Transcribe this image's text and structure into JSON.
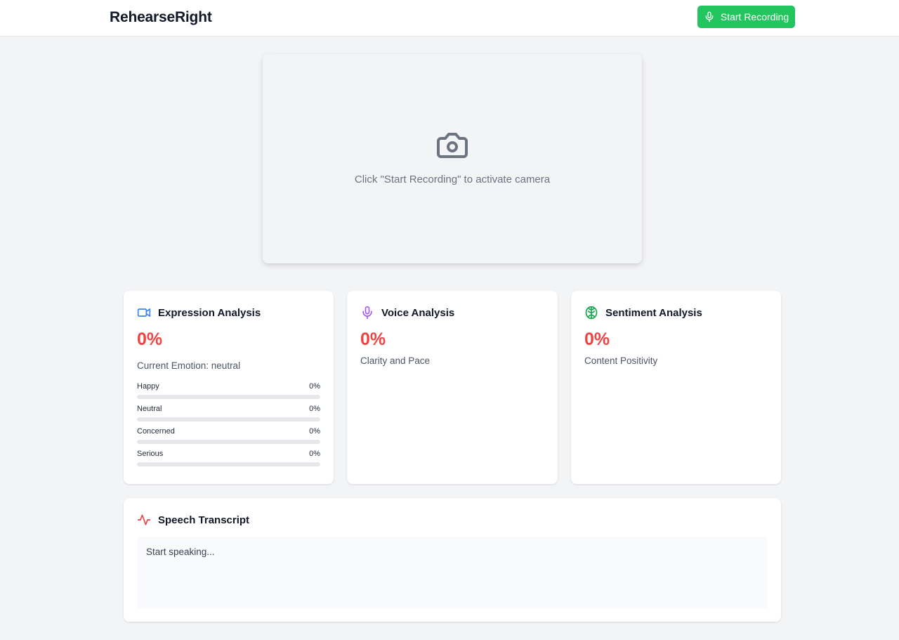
{
  "header": {
    "brand": "RehearseRight",
    "record_button_label": "Start Recording"
  },
  "camera": {
    "hint": "Click \"Start Recording\" to activate camera"
  },
  "expression": {
    "title": "Expression Analysis",
    "score": "0%",
    "current_emotion": "Current Emotion: neutral",
    "emotions": [
      {
        "label": "Happy",
        "percent": "0%",
        "level": 0
      },
      {
        "label": "Neutral",
        "percent": "0%",
        "level": 0
      },
      {
        "label": "Concerned",
        "percent": "0%",
        "level": 0
      },
      {
        "label": "Serious",
        "percent": "0%",
        "level": 0
      }
    ]
  },
  "voice": {
    "title": "Voice Analysis",
    "score": "0%",
    "subtitle": "Clarity and Pace"
  },
  "sentiment": {
    "title": "Sentiment Analysis",
    "score": "0%",
    "subtitle": "Content Positivity"
  },
  "transcript": {
    "title": "Speech Transcript",
    "placeholder": "Start speaking..."
  },
  "colors": {
    "accent_green": "#22c55e",
    "score_red": "#ef4444",
    "expression_icon": "#3b82f6",
    "voice_icon": "#a855f7",
    "sentiment_icon": "#16a34a",
    "transcript_icon": "#ef4444"
  },
  "icons": {
    "record_button": "microphone-icon",
    "camera": "camera-icon",
    "expression": "video-icon",
    "voice": "microphone-icon",
    "sentiment": "brain-icon",
    "transcript": "activity-icon"
  }
}
